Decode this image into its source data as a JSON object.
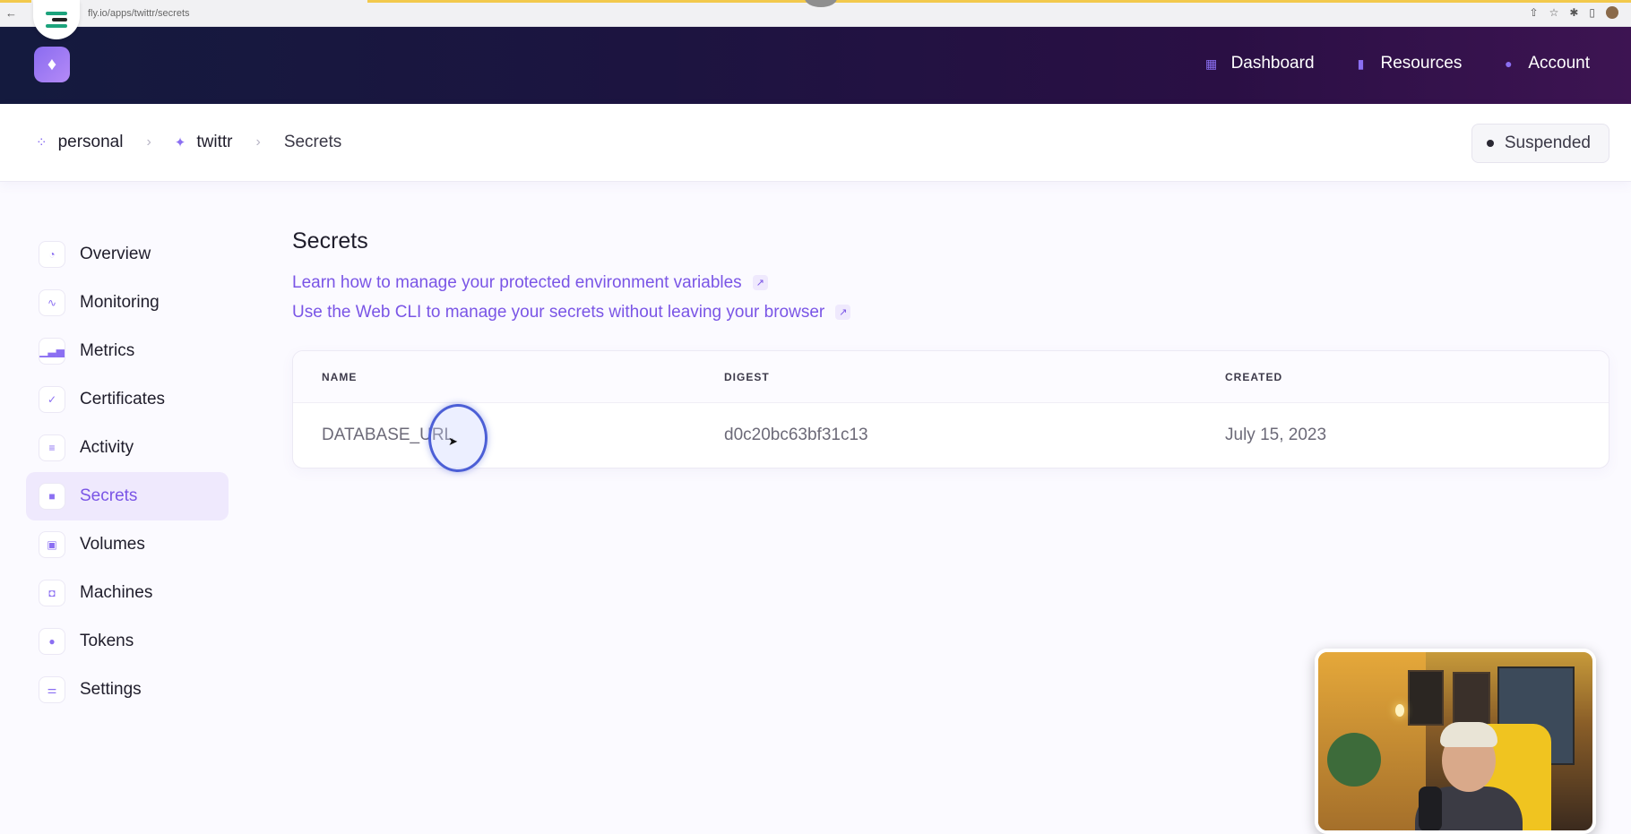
{
  "browser": {
    "url": "fly.io/apps/twittr/secrets",
    "nav_arrows": "← →"
  },
  "header": {
    "logo_icon": "balloon-logo",
    "nav": [
      {
        "label": "Dashboard",
        "icon": "grid-icon"
      },
      {
        "label": "Resources",
        "icon": "bookmark-icon"
      },
      {
        "label": "Account",
        "icon": "user-icon"
      }
    ]
  },
  "breadcrumb": {
    "items": [
      {
        "label": "personal",
        "icon": "org-icon"
      },
      {
        "label": "twittr",
        "icon": "sparkle-icon"
      },
      {
        "label": "Secrets"
      }
    ],
    "separator": "›"
  },
  "status": {
    "label": "Suspended"
  },
  "sidebar": {
    "items": [
      {
        "label": "Overview",
        "icon": "pie-icon"
      },
      {
        "label": "Monitoring",
        "icon": "pulse-icon"
      },
      {
        "label": "Metrics",
        "icon": "bar-chart-icon"
      },
      {
        "label": "Certificates",
        "icon": "badge-check-icon"
      },
      {
        "label": "Activity",
        "icon": "stack-icon"
      },
      {
        "label": "Secrets",
        "icon": "lock-icon",
        "active": true
      },
      {
        "label": "Volumes",
        "icon": "archive-icon"
      },
      {
        "label": "Machines",
        "icon": "cpu-icon"
      },
      {
        "label": "Tokens",
        "icon": "token-icon"
      },
      {
        "label": "Settings",
        "icon": "settings-icon"
      }
    ]
  },
  "main": {
    "title": "Secrets",
    "links": [
      {
        "label": "Learn how to manage your protected environment variables"
      },
      {
        "label": "Use the Web CLI to manage your secrets without leaving your browser"
      }
    ],
    "table": {
      "headers": [
        "NAME",
        "DIGEST",
        "CREATED"
      ],
      "rows": [
        {
          "name": "DATABASE_URL",
          "digest": "d0c20bc63bf31c13",
          "created": "July 15, 2023"
        }
      ]
    }
  },
  "colors": {
    "accent": "#7a55e6",
    "header_dark": "#1c1440",
    "click_ring": "#4c5fd6"
  }
}
